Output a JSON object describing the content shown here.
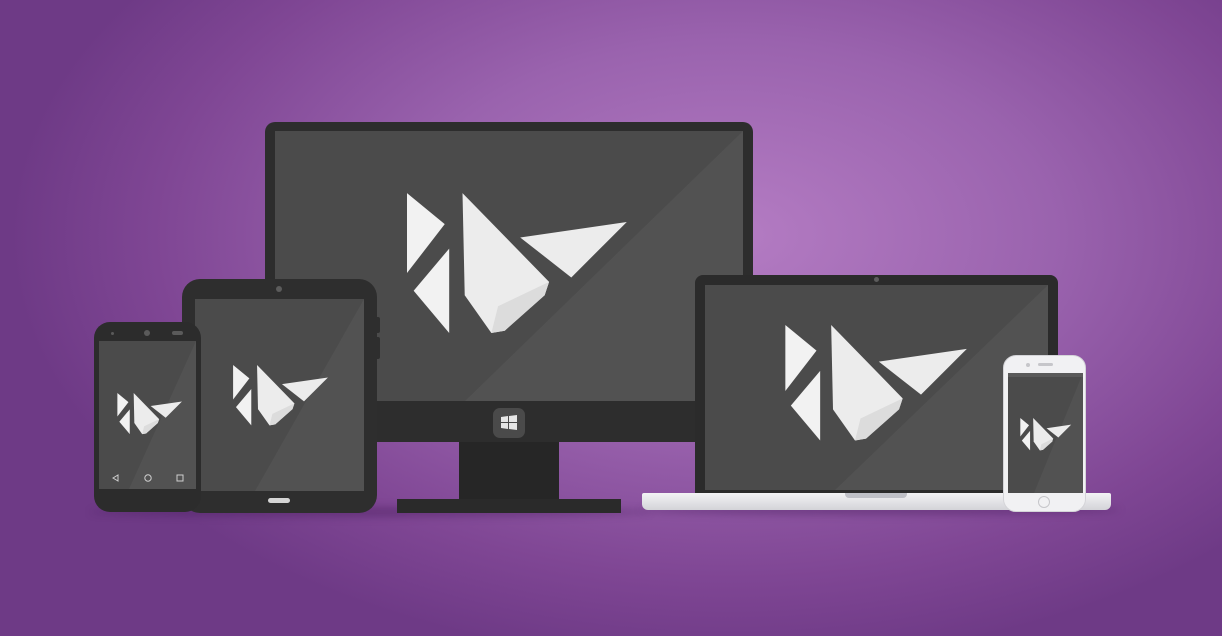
{
  "scene": {
    "background_color_center": "#b47cc3",
    "background_color_edge": "#6e3a86",
    "screen_color": "#4a4a4a",
    "logo_color": "#f2f2f2"
  },
  "devices": [
    {
      "name": "desktop-monitor",
      "logo": "kivy-logo",
      "taskbar_icon": "windows-icon"
    },
    {
      "name": "tablet",
      "logo": "kivy-logo"
    },
    {
      "name": "android-phone",
      "logo": "kivy-logo",
      "nav_icons": [
        "back-icon",
        "home-icon",
        "recents-icon"
      ]
    },
    {
      "name": "laptop",
      "logo": "kivy-logo"
    },
    {
      "name": "iphone",
      "logo": "kivy-logo"
    }
  ]
}
